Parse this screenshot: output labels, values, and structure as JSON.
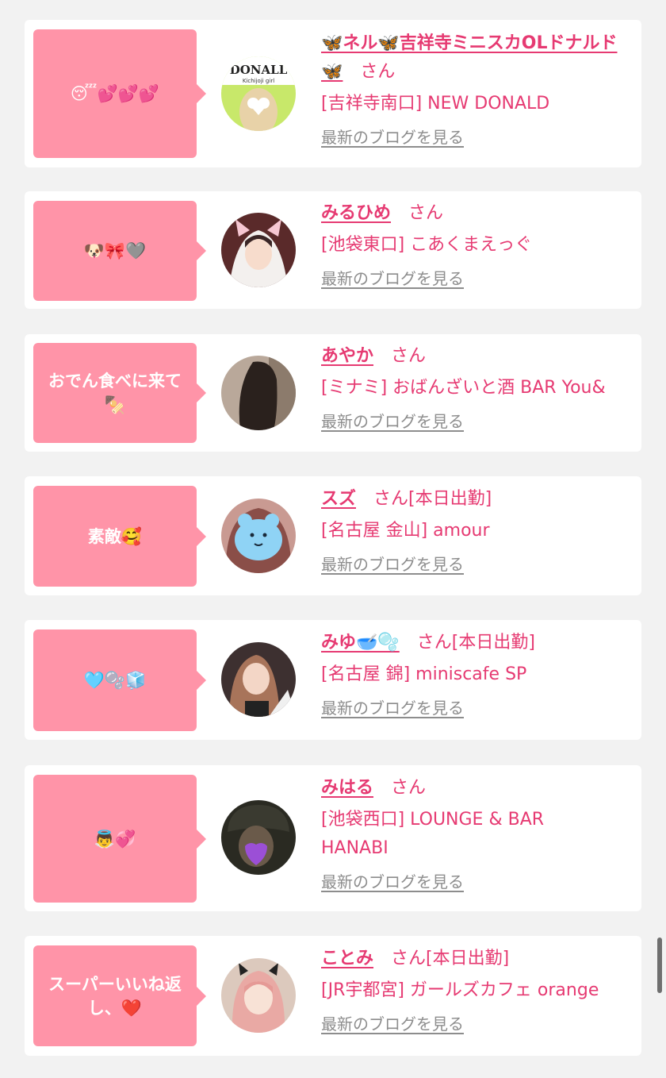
{
  "theme": {
    "accent": "#e63a72",
    "bubble_color": "#ff94a8",
    "background": "#f2f2f2",
    "link_gray": "#8d8d8d"
  },
  "posts": [
    {
      "comment": "😴💕💕💕",
      "name": "🦋ネル🦋吉祥寺ミニスカOLドナルド🦋",
      "suffix": "さん",
      "shop": "[吉祥寺南口] NEW DONALD",
      "blog_link": "最新のブログを見る",
      "avatar_caption": "DONALL",
      "avatar_subcaption": "Kichijoji girl"
    },
    {
      "comment": "🐶🎀🩶",
      "name": "みるひめ",
      "suffix": "さん",
      "shop": "[池袋東口] こあくまえっぐ",
      "blog_link": "最新のブログを見る"
    },
    {
      "comment": "おでん食べに来て🍢",
      "name": "あやか",
      "suffix": "さん",
      "shop": "[ミナミ] おばんざいと酒 BAR You&",
      "blog_link": "最新のブログを見る"
    },
    {
      "comment": "素敵🥰",
      "name": "スズ",
      "suffix": "さん[本日出勤]",
      "shop": "[名古屋 金山] amour",
      "blog_link": "最新のブログを見る"
    },
    {
      "comment": "🩵🫧🧊",
      "name": "みゆ🥣🫧",
      "suffix": "さん[本日出勤]",
      "shop": "[名古屋 錦] miniscafe SP",
      "blog_link": "最新のブログを見る"
    },
    {
      "comment": "👼💞",
      "name": "みはる",
      "suffix": "さん",
      "shop": "[池袋西口] LOUNGE & BAR HANABI",
      "blog_link": "最新のブログを見る"
    },
    {
      "comment": "スーパーいいね返し、❤️",
      "name": "ことみ",
      "suffix": "さん[本日出勤]",
      "shop": "[JR宇都宮] ガールズカフェ orange",
      "blog_link": "最新のブログを見る"
    }
  ]
}
